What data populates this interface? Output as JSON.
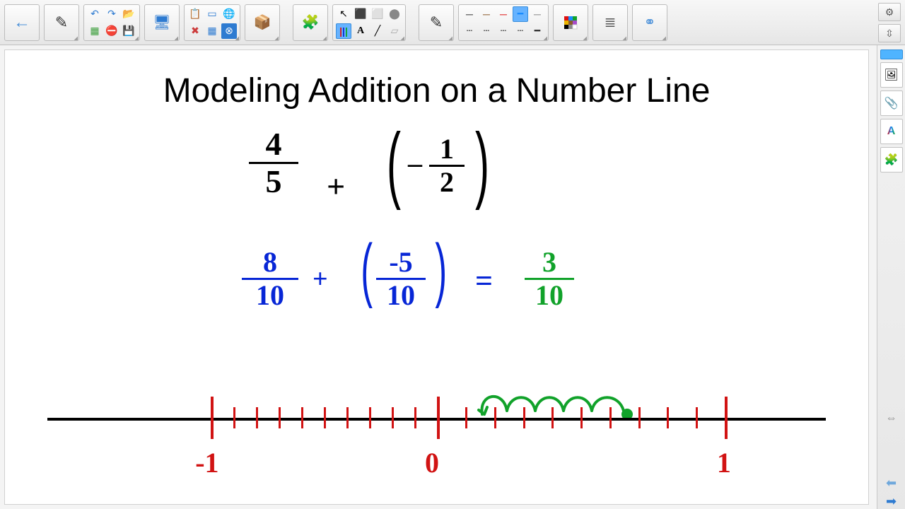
{
  "title": "Modeling Addition on a Number Line",
  "black_eq": {
    "f1_num": "4",
    "f1_den": "5",
    "plus": "+",
    "neg": "–",
    "fi_num": "1",
    "fi_den": "2"
  },
  "blue_eq": {
    "f1_num": "8",
    "f1_den": "10",
    "plus": "+",
    "f2_num": "-5",
    "f2_den": "10",
    "equals": "="
  },
  "green_ans": {
    "num": "3",
    "den": "10"
  },
  "numline": {
    "neg1": "-1",
    "zero": "0",
    "one": "1"
  },
  "icons": {
    "back": "←",
    "pen": "✎",
    "undo": "↶",
    "redo": "↷",
    "open": "📂",
    "new": "▦",
    "del": "⛔",
    "save": "💾",
    "display": "🖥",
    "paste": "📋",
    "screen": "▭",
    "globe": "🌐",
    "x": "✖",
    "table": "▦",
    "close": "⊗",
    "box": "📦",
    "puzzle": "🧩",
    "pointer": "↖",
    "obj": "⬛",
    "erase": "⬜",
    "eraser": "⬤",
    "pens": "│││",
    "textA": "A",
    "line": "╱",
    "erase2": "▱",
    "thin": "─",
    "brown": "─",
    "redln": "─",
    "cyan": "━",
    "grey": "─",
    "dash": "┄",
    "thick": "━",
    "palette": "▦",
    "align": "≣",
    "link": "⚭",
    "gear": "⚙",
    "vresize": "⇳",
    "tab": "▌",
    "img": "🖼",
    "clip": "📎",
    "styleA": "A̲",
    "puzzle2": "🧩",
    "hresize": "⇔",
    "prev": "⬅",
    "next": "➡"
  }
}
